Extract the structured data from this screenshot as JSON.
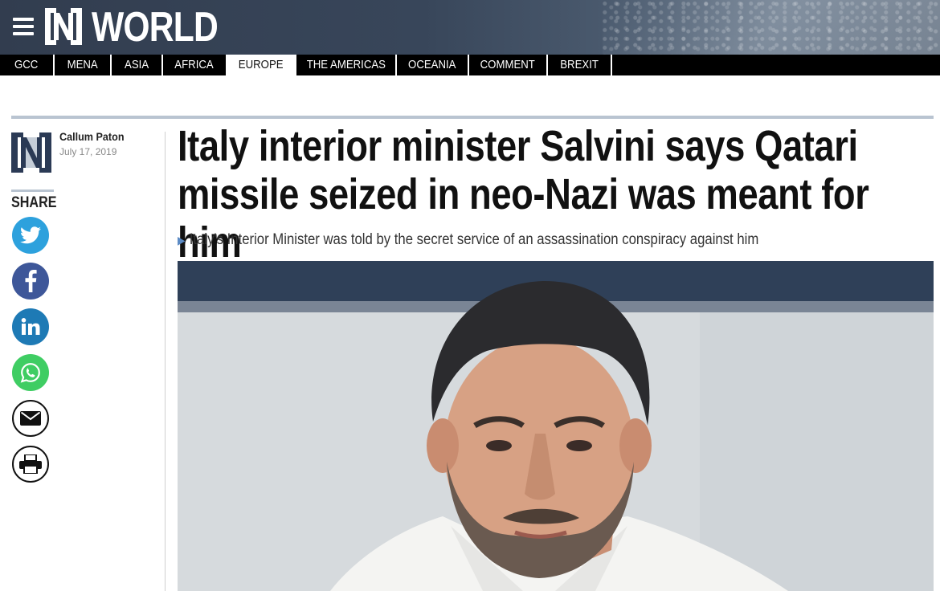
{
  "header": {
    "section_title": "WORLD",
    "menu_icon": "hamburger-menu-icon",
    "logo_icon": "the-national-logo"
  },
  "nav": {
    "items": [
      {
        "label": "GCC",
        "active": false
      },
      {
        "label": "MENA",
        "active": false
      },
      {
        "label": "ASIA",
        "active": false
      },
      {
        "label": "AFRICA",
        "active": false
      },
      {
        "label": "EUROPE",
        "active": true
      },
      {
        "label": "THE AMERICAS",
        "active": false
      },
      {
        "label": "OCEANIA",
        "active": false
      },
      {
        "label": "COMMENT",
        "active": false
      },
      {
        "label": "BREXIT",
        "active": false
      }
    ]
  },
  "author": {
    "name": "Callum Paton",
    "date": "July 17, 2019"
  },
  "share": {
    "label": "SHARE",
    "buttons": [
      "twitter-icon",
      "facebook-icon",
      "linkedin-icon",
      "whatsapp-icon",
      "email-icon",
      "print-icon"
    ]
  },
  "article": {
    "headline": "Italy interior minister Salvini says Qatari missile seized in neo-Nazi was meant for him",
    "standfirst": "Italy's Interior Minister was told by the secret service of an assassination conspiracy against him",
    "hero_image": "photo-of-matteo-salvini"
  },
  "colors": {
    "nav_background": "#000000",
    "accent_rule": "#b9c4d1",
    "twitter": "#2da1dd",
    "facebook": "#3e5799",
    "linkedin": "#1e7ab5",
    "whatsapp": "#3fcd63"
  }
}
